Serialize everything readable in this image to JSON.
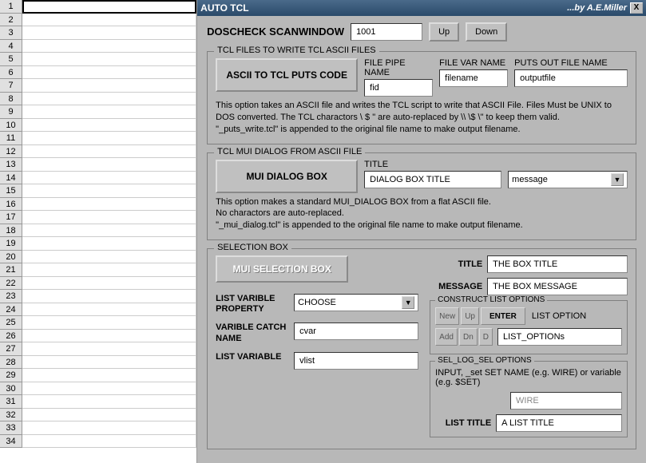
{
  "spreadsheet": {
    "rows": [
      "1",
      "2",
      "3",
      "4",
      "5",
      "6",
      "7",
      "8",
      "9",
      "10",
      "11",
      "12",
      "13",
      "14",
      "15",
      "16",
      "17",
      "18",
      "19",
      "20",
      "21",
      "22",
      "23",
      "24",
      "25",
      "26",
      "27",
      "28",
      "29",
      "30",
      "31",
      "32",
      "33",
      "34"
    ]
  },
  "titlebar": {
    "title": "AUTO TCL",
    "author": "...by A.E.Miller",
    "close": "X"
  },
  "doscheck": {
    "label": "DOSCHECK SCANWINDOW",
    "value": "1001",
    "up": "Up",
    "down": "Down"
  },
  "tcl_files": {
    "legend": "TCL FILES TO WRITE TCL ASCII FILES",
    "button": "ASCII TO TCL PUTS CODE",
    "pipe_label": "FILE PIPE NAME",
    "pipe_value": "fid",
    "var_label": "FILE VAR NAME",
    "var_value": "filename",
    "out_label": "PUTS OUT FILE NAME",
    "out_value": "outputfile",
    "desc1": "This option takes an ASCII file and writes the TCL script to write that ASCII File.  Files Must be UNIX to DOS converted.  The TCL charactors \\ $ \" are auto-replaced by \\\\ \\$ \\\" to keep them valid.",
    "desc2": "\"_puts_write.tcl\" is appended to the original file name to make output filename."
  },
  "mui_dialog": {
    "legend": "TCL MUI DIALOG FROM ASCII FILE",
    "button": "MUI DIALOG BOX",
    "title_label": "TITLE",
    "title_value": "DIALOG BOX TITLE",
    "type_value": "message",
    "desc1": "This option makes a standard MUI_DIALOG BOX from a flat ASCII file.",
    "desc2": "No charactors are auto-replaced.",
    "desc3": "\"_mui_dialog.tcl\" is appended to the original file name to make output filename."
  },
  "selection_box": {
    "legend": "SELECTION BOX",
    "button": "MUI SELECTION BOX",
    "title_label": "TITLE",
    "title_value": "THE BOX TITLE",
    "message_label": "MESSAGE",
    "message_value": "THE BOX MESSAGE",
    "list_prop_label": "LIST VARIBLE PROPERTY",
    "list_prop_value": "CHOOSE",
    "catch_label": "VARIBLE CATCH NAME",
    "catch_value": "cvar",
    "listvar_label": "LIST VARIABLE",
    "listvar_value": "vlist",
    "construct": {
      "legend": "CONSTRUCT LIST OPTIONS",
      "new": "New",
      "up": "Up",
      "enter": "ENTER",
      "add": "Add",
      "dn": "Dn",
      "d": "D",
      "option_label": "LIST OPTION",
      "option_value": "LIST_OPTIONs"
    },
    "sel_log": {
      "legend": "SEL_LOG_SEL OPTIONS",
      "desc": "INPUT, _set SET NAME (e.g. WIRE) or variable (e.g. $SET)",
      "wire_value": "WIRE",
      "list_title_label": "LIST TITLE",
      "list_title_value": "A LIST TITLE"
    }
  }
}
